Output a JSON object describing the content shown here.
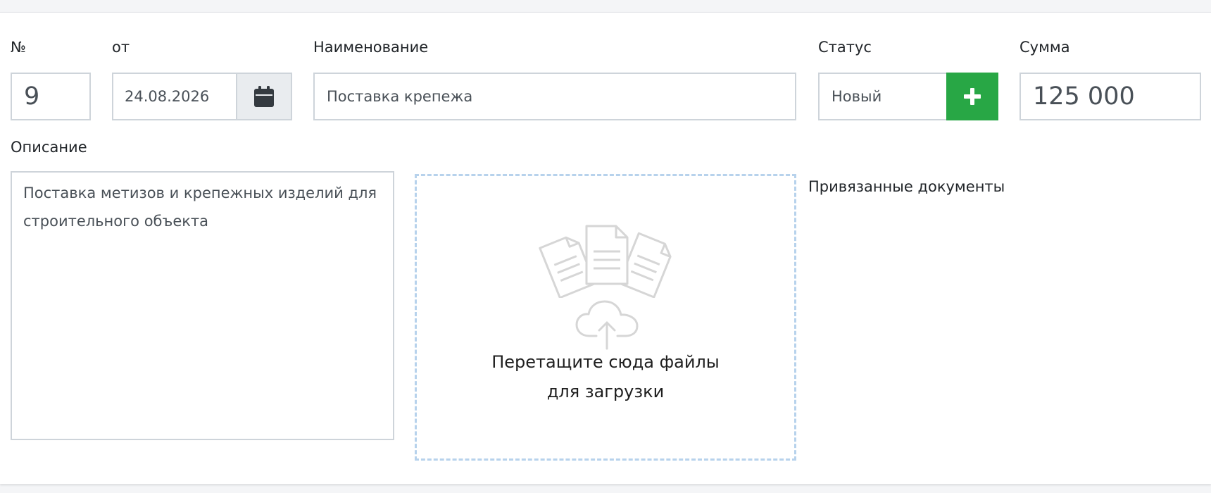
{
  "form": {
    "number": {
      "label": "№",
      "value": "9"
    },
    "date": {
      "label": "от",
      "value": "24.08.2026"
    },
    "name": {
      "label": "Наименование",
      "value": "Поставка крепежа"
    },
    "status": {
      "label": "Статус",
      "value": "Новый"
    },
    "sum": {
      "label": "Сумма",
      "value": "125 000"
    },
    "description": {
      "label": "Описание",
      "value": "Поставка метизов и крепежных изделий для строительного объекта"
    }
  },
  "dropzone": {
    "line1": "Перетащите сюда файлы",
    "line2": "для загрузки"
  },
  "linked_docs": {
    "label": "Привязанные документы"
  },
  "colors": {
    "accent_green": "#28a745",
    "dropzone_border": "#b7d2ec",
    "input_border": "#ced4da"
  },
  "icons": [
    "calendar-icon",
    "plus-icon",
    "documents-icon",
    "cloud-upload-icon"
  ]
}
